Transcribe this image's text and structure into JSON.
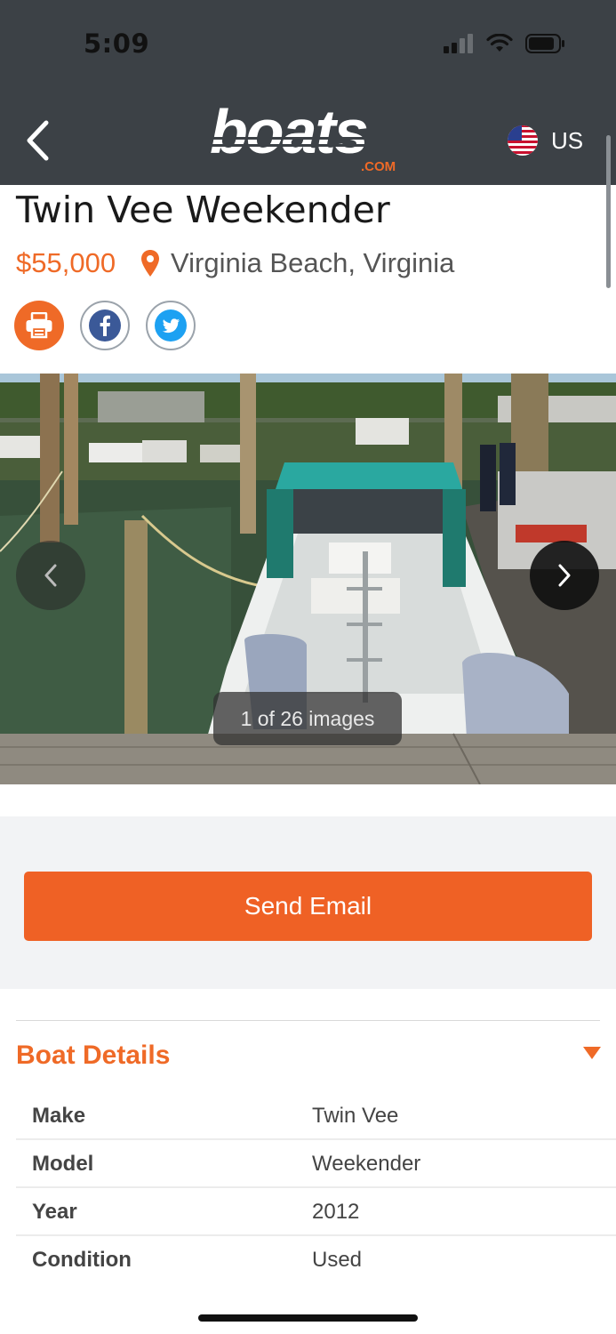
{
  "status_bar": {
    "time": "5:09"
  },
  "header": {
    "logo_text": "boats",
    "logo_sub": ".COM",
    "region_label": "US"
  },
  "listing": {
    "title": "Twin Vee Weekender",
    "price": "$55,000",
    "location": "Virginia Beach, Virginia"
  },
  "gallery": {
    "counter": "1 of 26 images"
  },
  "contact": {
    "send_email_label": "Send Email"
  },
  "details": {
    "heading": "Boat Details",
    "rows": [
      {
        "label": "Make",
        "value": "Twin Vee"
      },
      {
        "label": "Model",
        "value": "Weekender"
      },
      {
        "label": "Year",
        "value": "2012"
      },
      {
        "label": "Condition",
        "value": "Used"
      }
    ]
  },
  "colors": {
    "accent": "#ef6a27",
    "button": "#ef6125",
    "header_bg": "#3c4146"
  }
}
